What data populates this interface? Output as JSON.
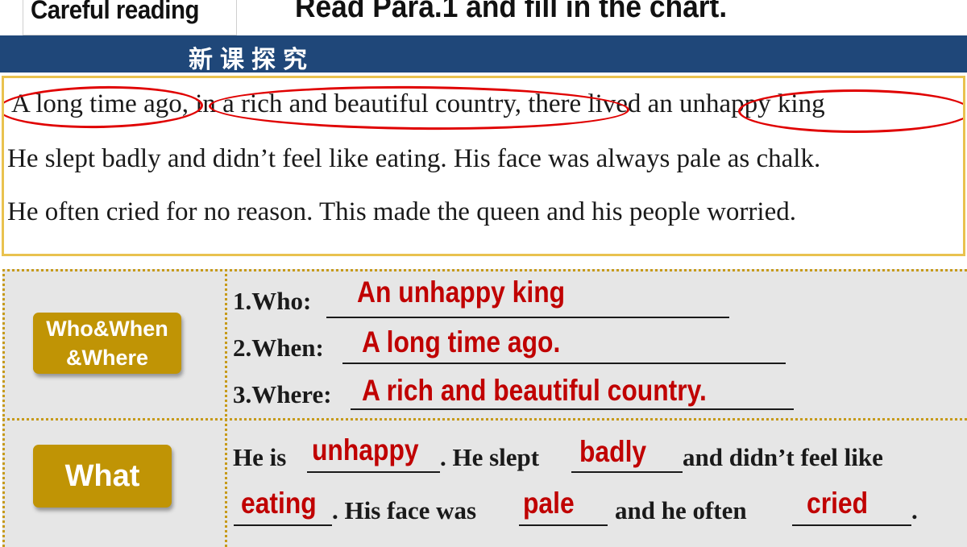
{
  "header": {
    "tag": "Careful reading",
    "instruction": "Read Para.1 and fill in the chart."
  },
  "banner": {
    "title": "新课探究"
  },
  "passage": {
    "line1": "A long time ago, in a rich and beautiful country, there lived an unhappy king",
    "line2": "He slept badly and didn’t feel like eating. His face was always pale as chalk.",
    "line3": "He often cried for no reason. This made the queen and his people worried."
  },
  "chart": {
    "row1": {
      "label": "Who&When\n&Where",
      "who_prompt": "1.Who:",
      "who_answer": "An unhappy king",
      "when_prompt": "2.When:",
      "when_answer": "A long time ago.",
      "where_prompt": "3.Where:",
      "where_answer": "A rich and beautiful country."
    },
    "row2": {
      "label": "What",
      "t1": "He is",
      "a1": "unhappy",
      "t2": ". He slept",
      "a2": "badly",
      "t3": "and didn’t feel like",
      "a3": "eating",
      "t4": ". His face was",
      "a4": "pale",
      "t5": "and he often",
      "a5": "cried",
      "t6": "."
    }
  },
  "colors": {
    "banner": "#1f4779",
    "highlight_ellipse": "#e00000",
    "answer": "#c00000",
    "label_button": "#c09405",
    "passage_border": "#e9c24f"
  }
}
